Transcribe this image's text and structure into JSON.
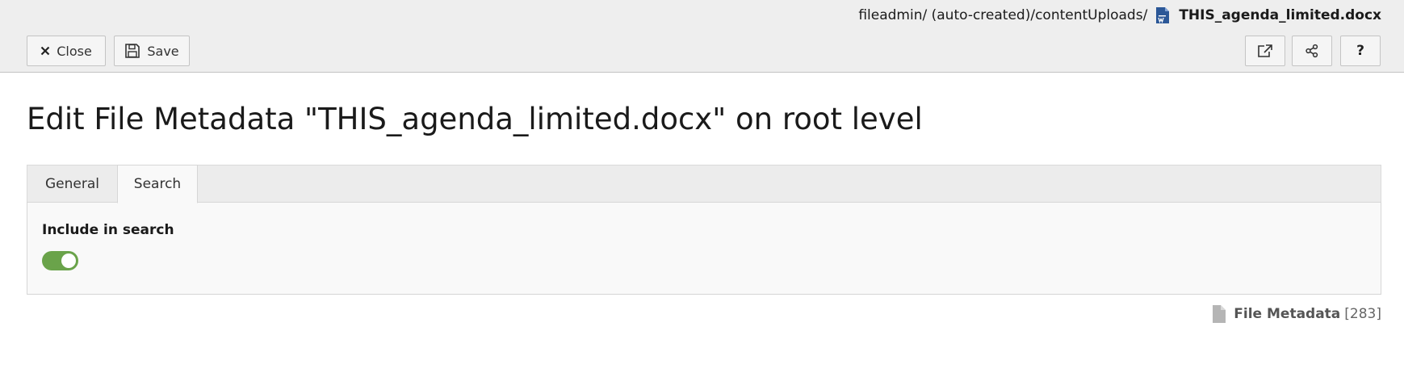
{
  "breadcrumb": {
    "path": "fileadmin/ (auto-created)/contentUploads/",
    "file_icon": "word-document-icon",
    "filename": "THIS_agenda_limited.docx"
  },
  "toolbar": {
    "close_label": "Close",
    "close_icon": "close-icon",
    "save_label": "Save",
    "save_icon": "save-icon",
    "open_icon": "open-external-icon",
    "share_icon": "share-icon",
    "help_icon": "help-icon",
    "help_glyph": "?"
  },
  "page": {
    "title": "Edit File Metadata \"THIS_agenda_limited.docx\" on root level"
  },
  "tabs": [
    {
      "label": "General",
      "active": false
    },
    {
      "label": "Search",
      "active": true
    }
  ],
  "search_tab": {
    "field_label": "Include in search",
    "toggle_on": true
  },
  "record": {
    "icon": "file-icon",
    "type": "File Metadata",
    "id": "[283]"
  },
  "colors": {
    "toggle_on": "#6aa34a",
    "header_bg": "#eeeeee",
    "word_blue": "#2b5797"
  }
}
